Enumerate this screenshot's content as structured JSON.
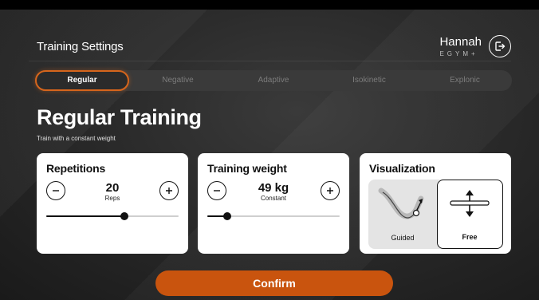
{
  "header": {
    "title": "Training Settings",
    "user_name": "Hannah",
    "brand": "EGYM+"
  },
  "tabs": [
    {
      "label": "Regular",
      "active": true
    },
    {
      "label": "Negative",
      "active": false
    },
    {
      "label": "Adaptive",
      "active": false
    },
    {
      "label": "Isokinetic",
      "active": false
    },
    {
      "label": "Explonic",
      "active": false
    }
  ],
  "main": {
    "heading": "Regular Training",
    "subheading": "Train with a constant weight"
  },
  "cards": {
    "repetitions": {
      "title": "Repetitions",
      "value": "20",
      "unit": "Reps",
      "slider_fraction": 0.59
    },
    "weight": {
      "title": "Training weight",
      "value": "49 kg",
      "unit": "Constant",
      "slider_fraction": 0.15
    },
    "visualization": {
      "title": "Visualization",
      "options": [
        {
          "label": "Guided",
          "selected": false
        },
        {
          "label": "Free",
          "selected": true
        }
      ]
    }
  },
  "confirm_label": "Confirm",
  "colors": {
    "accent": "#d6651c",
    "confirm": "#c9540e"
  }
}
